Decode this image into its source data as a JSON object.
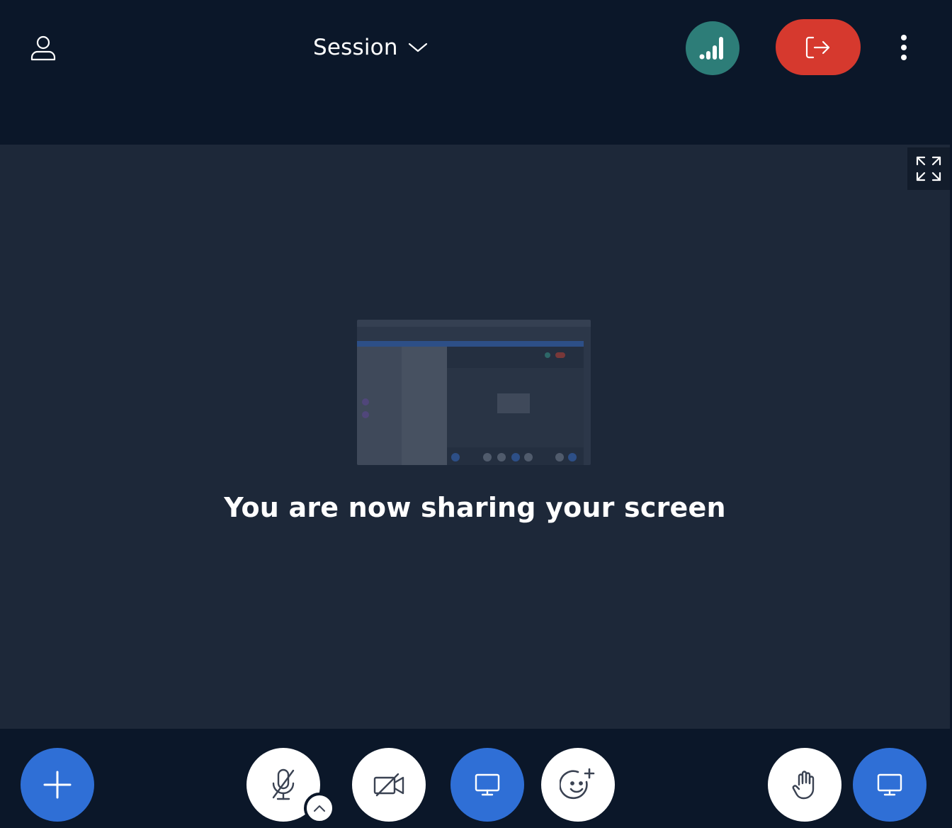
{
  "header": {
    "session_label": "Session",
    "icons": {
      "user": "user-icon",
      "chevron": "chevron-down-icon",
      "connection": "signal-bars-icon",
      "leave": "exit-icon",
      "more": "kebab-menu-icon"
    },
    "colors": {
      "connection_bg": "#2d7d78",
      "leave_bg": "#d6392e"
    }
  },
  "stage": {
    "message": "You are now sharing your screen"
  },
  "footer": {
    "icons": {
      "add": "plus-icon",
      "mic": "microphone-muted-icon",
      "mic_options": "chevron-up-icon",
      "camera": "video-off-icon",
      "screenshare": "monitor-icon",
      "reaction": "emoji-add-icon",
      "raise_hand": "hand-icon",
      "presentation": "monitor-icon"
    },
    "colors": {
      "accent": "#2f6fd6",
      "bar_bg": "#0b1729",
      "stage_bg": "#1d2839"
    }
  }
}
